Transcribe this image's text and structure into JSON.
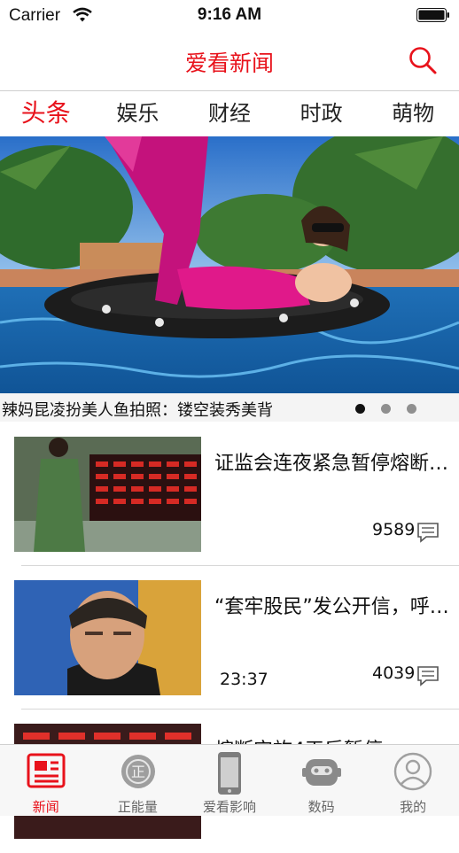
{
  "status": {
    "carrier": "Carrier",
    "time": "9:16 AM"
  },
  "nav": {
    "title": "爱看新闻",
    "search_icon": "search-icon"
  },
  "tabs": [
    {
      "label": "头条",
      "active": true
    },
    {
      "label": "娱乐",
      "active": false
    },
    {
      "label": "财经",
      "active": false
    },
    {
      "label": "时政",
      "active": false
    },
    {
      "label": "萌物",
      "active": false
    }
  ],
  "banner": {
    "caption": "辣妈昆凌扮美人鱼拍照：镂空装秀美背",
    "page_count": 3,
    "current_page": 1
  },
  "news": [
    {
      "title": "证监会连夜紧急暂停熔断机制",
      "time": "",
      "comments": "9589"
    },
    {
      "title": "“套牢股民”发公开信，呼吁肖钢下台",
      "time": "23:37",
      "comments": "4039"
    },
    {
      "title": "熔断实施4天后暂停",
      "time": "",
      "comments": ""
    }
  ],
  "tabbar": [
    {
      "label": "新闻",
      "icon": "newspaper-icon",
      "active": true
    },
    {
      "label": "正能量",
      "icon": "badge-icon",
      "active": false
    },
    {
      "label": "爱看影响",
      "icon": "phone-icon",
      "active": false
    },
    {
      "label": "数码",
      "icon": "robot-icon",
      "active": false
    },
    {
      "label": "我的",
      "icon": "profile-icon",
      "active": false
    }
  ],
  "colors": {
    "accent": "#e8121b",
    "divider": "#d7d7d7"
  }
}
